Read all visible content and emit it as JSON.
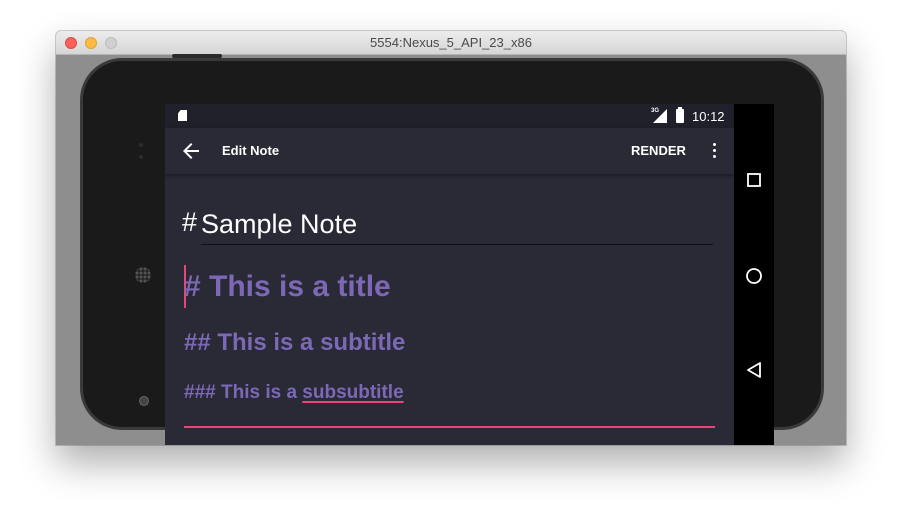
{
  "window": {
    "title": "5554:Nexus_5_API_23_x86"
  },
  "status_bar": {
    "time": "10:12",
    "network": "3G",
    "icons": [
      "sd-card-icon",
      "signal-icon",
      "battery-icon"
    ]
  },
  "app_bar": {
    "title": "Edit Note",
    "back_icon": "arrow-back-icon",
    "render_label": "RENDER",
    "overflow_icon": "more-vert-icon"
  },
  "note": {
    "title_prefix": "#",
    "title": "Sample Note",
    "body": {
      "line1": "# This is a title",
      "line2": "## This is a subtitle",
      "line3_prefix": "### This is a ",
      "line3_misspelled": "subsubtitle"
    }
  },
  "navigation": {
    "items": [
      "recents-icon",
      "home-icon",
      "back-triangle-icon"
    ]
  },
  "colors": {
    "screen_bg": "#292a36",
    "status_bar_bg": "#1f2029",
    "markdown_text": "#7d68b5",
    "accent": "#e5477a"
  }
}
